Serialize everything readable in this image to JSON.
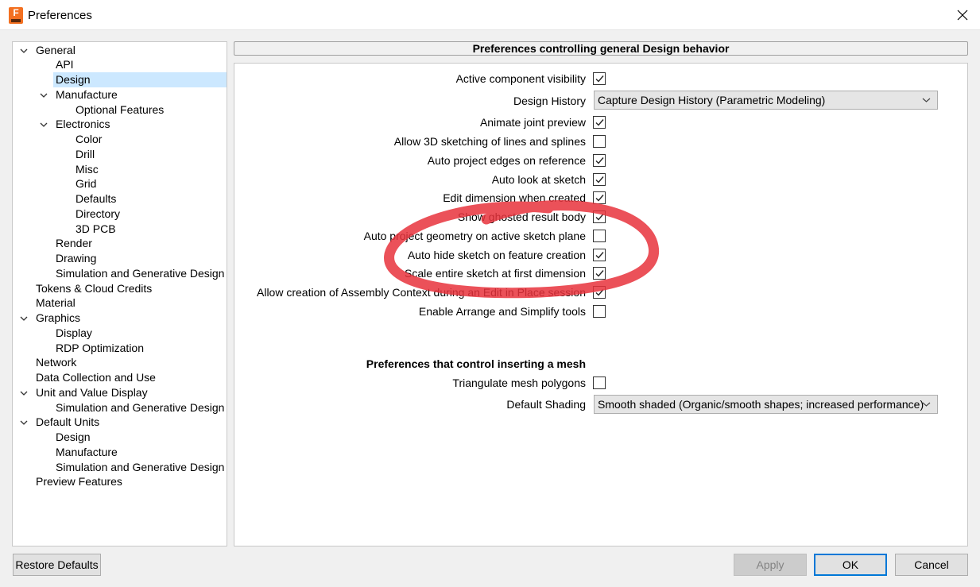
{
  "window": {
    "title": "Preferences"
  },
  "tree": {
    "items": [
      {
        "label": "General",
        "expanded": true
      },
      {
        "label": "API"
      },
      {
        "label": "Design",
        "selected": true
      },
      {
        "label": "Manufacture",
        "expanded": true
      },
      {
        "label": "Optional Features"
      },
      {
        "label": "Electronics",
        "expanded": true
      },
      {
        "label": "Color"
      },
      {
        "label": "Drill"
      },
      {
        "label": "Misc"
      },
      {
        "label": "Grid"
      },
      {
        "label": "Defaults"
      },
      {
        "label": "Directory"
      },
      {
        "label": "3D PCB"
      },
      {
        "label": "Render"
      },
      {
        "label": "Drawing"
      },
      {
        "label": "Simulation and Generative Design"
      },
      {
        "label": "Tokens & Cloud Credits"
      },
      {
        "label": "Material"
      },
      {
        "label": "Graphics",
        "expanded": true
      },
      {
        "label": "Display"
      },
      {
        "label": "RDP Optimization"
      },
      {
        "label": "Network"
      },
      {
        "label": "Data Collection and Use"
      },
      {
        "label": "Unit and Value Display",
        "expanded": true
      },
      {
        "label": "Simulation and Generative Design"
      },
      {
        "label": "Default Units",
        "expanded": true
      },
      {
        "label": "Design"
      },
      {
        "label": "Manufacture"
      },
      {
        "label": "Simulation and Generative Design"
      },
      {
        "label": "Preview Features"
      }
    ]
  },
  "main": {
    "header": "Preferences controlling general Design behavior",
    "settings": [
      {
        "label": "Active component visibility",
        "checked": true
      },
      {
        "label": "Design History",
        "value": "Capture Design History (Parametric Modeling)"
      },
      {
        "label": "Animate joint preview",
        "checked": true
      },
      {
        "label": "Allow 3D sketching of lines and splines",
        "checked": false
      },
      {
        "label": "Auto project edges on reference",
        "checked": true
      },
      {
        "label": "Auto look at sketch",
        "checked": true
      },
      {
        "label": "Edit dimension when created",
        "checked": true
      },
      {
        "label": "Show ghosted result body",
        "checked": true
      },
      {
        "label": "Auto project geometry on active sketch plane",
        "checked": false
      },
      {
        "label": "Auto hide sketch on feature creation",
        "checked": true
      },
      {
        "label": "Scale entire sketch at first dimension",
        "checked": true
      },
      {
        "label": "Allow creation of Assembly Context during an Edit in Place session",
        "checked": true
      },
      {
        "label": "Enable Arrange and Simplify tools",
        "checked": false
      }
    ],
    "mesh_section_title": "Preferences that control inserting a mesh",
    "mesh_settings": [
      {
        "label": "Triangulate mesh polygons",
        "checked": false
      },
      {
        "label": "Default Shading",
        "value": "Smooth shaded (Organic/smooth shapes; increased performance)"
      }
    ]
  },
  "buttons": {
    "restore_defaults": "Restore Defaults",
    "apply": "Apply",
    "ok": "OK",
    "cancel": "Cancel"
  },
  "colors": {
    "annotation": "#e8323c",
    "selection": "#cce8ff",
    "accent": "#0078d7"
  }
}
